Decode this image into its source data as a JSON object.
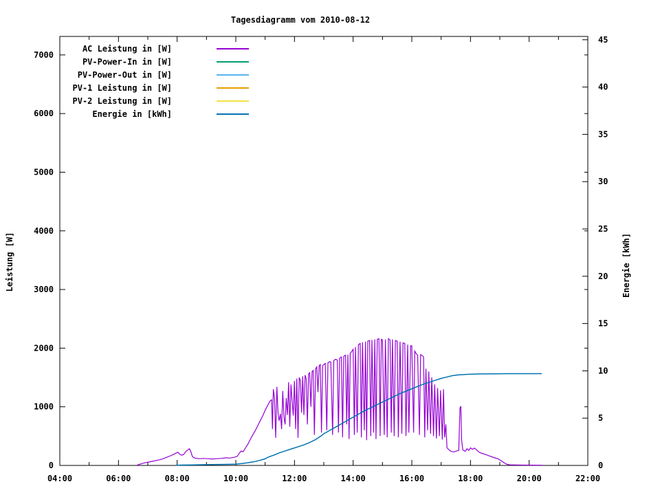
{
  "chart_data": {
    "type": "line",
    "title": "Tagesdiagramm vom 2010-08-12",
    "grid": false,
    "legend_position": "top-left-inside",
    "x_axis": {
      "unit": "time of day",
      "range_hours": [
        4,
        22
      ],
      "major_hours": [
        4,
        6,
        8,
        10,
        12,
        14,
        16,
        18,
        20,
        22
      ],
      "major_labels": [
        "04:00",
        "06:00",
        "08:00",
        "10:00",
        "12:00",
        "14:00",
        "16:00",
        "18:00",
        "20:00",
        "22:00"
      ],
      "minor_hours": [
        5,
        7,
        9,
        11,
        13,
        15,
        17,
        19,
        21
      ]
    },
    "y_left_axis": {
      "label": "Leistung [W]",
      "range": [
        0,
        7315
      ],
      "tick_values": [
        0,
        1000,
        2000,
        3000,
        4000,
        5000,
        6000,
        7000
      ],
      "tick_labels": [
        "0",
        "1000",
        "2000",
        "3000",
        "4000",
        "5000",
        "6000",
        "7000"
      ]
    },
    "y_right_axis": {
      "label": "Energie [kWh]",
      "range": [
        0,
        45.35
      ],
      "tick_values": [
        0,
        5,
        10,
        15,
        20,
        25,
        30,
        35,
        40,
        45
      ],
      "tick_labels": [
        "0",
        "5",
        "10",
        "15",
        "20",
        "25",
        "30",
        "35",
        "40",
        "45"
      ]
    },
    "series": [
      {
        "name": "AC Leistung in [W]",
        "color": "#9400d3",
        "axis": "left",
        "points": [
          [
            6.62,
            2
          ],
          [
            6.75,
            25
          ],
          [
            6.9,
            45
          ],
          [
            7.05,
            60
          ],
          [
            7.2,
            75
          ],
          [
            7.35,
            90
          ],
          [
            7.5,
            110
          ],
          [
            7.65,
            140
          ],
          [
            7.8,
            170
          ],
          [
            7.9,
            195
          ],
          [
            7.98,
            215
          ],
          [
            8.03,
            225
          ],
          [
            8.08,
            195
          ],
          [
            8.15,
            175
          ],
          [
            8.22,
            185
          ],
          [
            8.3,
            240
          ],
          [
            8.42,
            285
          ],
          [
            8.47,
            230
          ],
          [
            8.52,
            150
          ],
          [
            8.6,
            125
          ],
          [
            8.75,
            115
          ],
          [
            8.9,
            120
          ],
          [
            9.05,
            115
          ],
          [
            9.2,
            110
          ],
          [
            9.35,
            115
          ],
          [
            9.5,
            120
          ],
          [
            9.65,
            130
          ],
          [
            9.8,
            125
          ],
          [
            9.95,
            140
          ],
          [
            10.05,
            155
          ],
          [
            10.12,
            210
          ],
          [
            10.18,
            245
          ],
          [
            10.25,
            235
          ],
          [
            10.33,
            300
          ],
          [
            10.42,
            370
          ],
          [
            10.5,
            450
          ],
          [
            10.58,
            520
          ],
          [
            10.67,
            600
          ],
          [
            10.75,
            680
          ],
          [
            10.83,
            760
          ],
          [
            10.92,
            850
          ],
          [
            11.0,
            940
          ],
          [
            11.08,
            1020
          ],
          [
            11.17,
            1100
          ],
          [
            11.22,
            1120
          ],
          [
            11.25,
            620
          ],
          [
            11.28,
            1300
          ],
          [
            11.32,
            1150
          ],
          [
            11.36,
            470
          ],
          [
            11.4,
            1340
          ],
          [
            11.44,
            900
          ],
          [
            11.48,
            760
          ],
          [
            11.52,
            880
          ],
          [
            11.56,
            620
          ],
          [
            11.6,
            1270
          ],
          [
            11.64,
            830
          ],
          [
            11.68,
            700
          ],
          [
            11.72,
            1150
          ],
          [
            11.76,
            860
          ],
          [
            11.8,
            1420
          ],
          [
            11.84,
            660
          ],
          [
            11.88,
            1380
          ],
          [
            11.92,
            1100
          ],
          [
            11.96,
            850
          ],
          [
            12.0,
            1440
          ],
          [
            12.04,
            620
          ],
          [
            12.08,
            1480
          ],
          [
            12.12,
            470
          ],
          [
            12.16,
            1500
          ],
          [
            12.2,
            1450
          ],
          [
            12.24,
            900
          ],
          [
            12.28,
            1520
          ],
          [
            12.32,
            860
          ],
          [
            12.36,
            1540
          ],
          [
            12.4,
            1480
          ],
          [
            12.44,
            700
          ],
          [
            12.48,
            1560
          ],
          [
            12.52,
            1580
          ],
          [
            12.56,
            1000
          ],
          [
            12.6,
            1600
          ],
          [
            12.64,
            1620
          ],
          [
            12.68,
            520
          ],
          [
            12.72,
            1650
          ],
          [
            12.76,
            1680
          ],
          [
            12.8,
            1250
          ],
          [
            12.84,
            1700
          ],
          [
            12.88,
            1720
          ],
          [
            12.92,
            560
          ],
          [
            12.96,
            1700
          ],
          [
            13.0,
            1720
          ],
          [
            13.05,
            1740
          ],
          [
            13.1,
            600
          ],
          [
            13.14,
            1750
          ],
          [
            13.2,
            1770
          ],
          [
            13.24,
            1760
          ],
          [
            13.3,
            520
          ],
          [
            13.34,
            1790
          ],
          [
            13.4,
            1810
          ],
          [
            13.46,
            1800
          ],
          [
            13.5,
            560
          ],
          [
            13.54,
            1830
          ],
          [
            13.6,
            1850
          ],
          [
            13.64,
            480
          ],
          [
            13.68,
            1860
          ],
          [
            13.74,
            1880
          ],
          [
            13.78,
            700
          ],
          [
            13.82,
            1890
          ],
          [
            13.86,
            450
          ],
          [
            13.9,
            1910
          ],
          [
            13.96,
            1950
          ],
          [
            14.0,
            1980
          ],
          [
            14.04,
            520
          ],
          [
            14.08,
            2020
          ],
          [
            14.14,
            560
          ],
          [
            14.18,
            2060
          ],
          [
            14.24,
            2080
          ],
          [
            14.28,
            480
          ],
          [
            14.32,
            2100
          ],
          [
            14.38,
            600
          ],
          [
            14.42,
            2110
          ],
          [
            14.46,
            430
          ],
          [
            14.5,
            2120
          ],
          [
            14.56,
            2130
          ],
          [
            14.6,
            500
          ],
          [
            14.64,
            2140
          ],
          [
            14.7,
            560
          ],
          [
            14.74,
            2150
          ],
          [
            14.78,
            450
          ],
          [
            14.82,
            2150
          ],
          [
            14.88,
            2160
          ],
          [
            14.92,
            500
          ],
          [
            14.96,
            2150
          ],
          [
            15.0,
            2140
          ],
          [
            15.06,
            520
          ],
          [
            15.1,
            2150
          ],
          [
            15.16,
            480
          ],
          [
            15.2,
            2160
          ],
          [
            15.26,
            2140
          ],
          [
            15.3,
            560
          ],
          [
            15.34,
            2150
          ],
          [
            15.4,
            500
          ],
          [
            15.44,
            2130
          ],
          [
            15.5,
            2120
          ],
          [
            15.54,
            480
          ],
          [
            15.6,
            2110
          ],
          [
            15.66,
            540
          ],
          [
            15.7,
            2090
          ],
          [
            15.76,
            2080
          ],
          [
            15.8,
            500
          ],
          [
            15.86,
            2060
          ],
          [
            15.9,
            560
          ],
          [
            15.96,
            2040
          ],
          [
            16.0,
            2040
          ],
          [
            16.06,
            560
          ],
          [
            16.1,
            1950
          ],
          [
            16.16,
            1900
          ],
          [
            16.2,
            1880
          ],
          [
            16.26,
            520
          ],
          [
            16.3,
            1890
          ],
          [
            16.36,
            1870
          ],
          [
            16.4,
            1850
          ],
          [
            16.44,
            480
          ],
          [
            16.48,
            1650
          ],
          [
            16.54,
            600
          ],
          [
            16.58,
            1600
          ],
          [
            16.64,
            540
          ],
          [
            16.68,
            1500
          ],
          [
            16.74,
            500
          ],
          [
            16.78,
            1380
          ],
          [
            16.84,
            460
          ],
          [
            16.88,
            1320
          ],
          [
            16.94,
            500
          ],
          [
            16.98,
            1280
          ],
          [
            17.04,
            440
          ],
          [
            17.08,
            1300
          ],
          [
            17.12,
            480
          ],
          [
            17.16,
            700
          ],
          [
            17.2,
            300
          ],
          [
            17.24,
            280
          ],
          [
            17.32,
            245
          ],
          [
            17.42,
            230
          ],
          [
            17.52,
            245
          ],
          [
            17.6,
            255
          ],
          [
            17.64,
            980
          ],
          [
            17.67,
            1010
          ],
          [
            17.7,
            430
          ],
          [
            17.74,
            265
          ],
          [
            17.82,
            240
          ],
          [
            17.88,
            285
          ],
          [
            17.94,
            255
          ],
          [
            18.0,
            300
          ],
          [
            18.06,
            275
          ],
          [
            18.14,
            295
          ],
          [
            18.22,
            260
          ],
          [
            18.3,
            225
          ],
          [
            18.4,
            205
          ],
          [
            18.52,
            185
          ],
          [
            18.66,
            160
          ],
          [
            18.8,
            135
          ],
          [
            18.95,
            110
          ],
          [
            19.05,
            80
          ],
          [
            19.15,
            45
          ],
          [
            19.25,
            18
          ],
          [
            19.35,
            10
          ],
          [
            19.6,
            8
          ],
          [
            19.9,
            6
          ],
          [
            20.2,
            5
          ],
          [
            20.47,
            4
          ]
        ]
      },
      {
        "name": "PV-Power-In in [W]",
        "color": "#009e73",
        "axis": "left",
        "points": []
      },
      {
        "name": "PV-Power-Out in [W]",
        "color": "#56b4e9",
        "axis": "left",
        "points": []
      },
      {
        "name": "PV-1 Leistung in [W]",
        "color": "#e69f00",
        "axis": "left",
        "points": []
      },
      {
        "name": "PV-2 Leistung in [W]",
        "color": "#f0e442",
        "axis": "left",
        "points": []
      },
      {
        "name": "Energie in [kWh]",
        "color": "#0072b2",
        "axis": "right",
        "points": [
          [
            7.95,
            0.02
          ],
          [
            8.2,
            0.04
          ],
          [
            8.5,
            0.05
          ],
          [
            8.8,
            0.07
          ],
          [
            9.0,
            0.08
          ],
          [
            9.3,
            0.1
          ],
          [
            9.6,
            0.11
          ],
          [
            9.9,
            0.13
          ],
          [
            10.0,
            0.14
          ],
          [
            10.2,
            0.2
          ],
          [
            10.4,
            0.28
          ],
          [
            10.6,
            0.38
          ],
          [
            10.8,
            0.52
          ],
          [
            11.0,
            0.7
          ],
          [
            11.1,
            0.87
          ],
          [
            11.3,
            1.1
          ],
          [
            11.5,
            1.35
          ],
          [
            11.7,
            1.55
          ],
          [
            11.9,
            1.75
          ],
          [
            12.1,
            1.95
          ],
          [
            12.3,
            2.15
          ],
          [
            12.5,
            2.4
          ],
          [
            12.7,
            2.7
          ],
          [
            12.9,
            3.1
          ],
          [
            13.0,
            3.35
          ],
          [
            13.2,
            3.7
          ],
          [
            13.4,
            4.05
          ],
          [
            13.6,
            4.4
          ],
          [
            13.8,
            4.75
          ],
          [
            14.0,
            5.1
          ],
          [
            14.2,
            5.45
          ],
          [
            14.4,
            5.8
          ],
          [
            14.6,
            6.1
          ],
          [
            14.8,
            6.4
          ],
          [
            15.0,
            6.7
          ],
          [
            15.2,
            7.0
          ],
          [
            15.4,
            7.3
          ],
          [
            15.6,
            7.6
          ],
          [
            15.8,
            7.85
          ],
          [
            16.0,
            8.1
          ],
          [
            16.2,
            8.35
          ],
          [
            16.4,
            8.6
          ],
          [
            16.6,
            8.8
          ],
          [
            16.8,
            9.0
          ],
          [
            17.0,
            9.2
          ],
          [
            17.2,
            9.35
          ],
          [
            17.4,
            9.5
          ],
          [
            17.6,
            9.58
          ],
          [
            17.9,
            9.63
          ],
          [
            18.3,
            9.67
          ],
          [
            18.8,
            9.69
          ],
          [
            19.3,
            9.7
          ],
          [
            20.0,
            9.7
          ],
          [
            20.43,
            9.7
          ]
        ]
      }
    ]
  }
}
